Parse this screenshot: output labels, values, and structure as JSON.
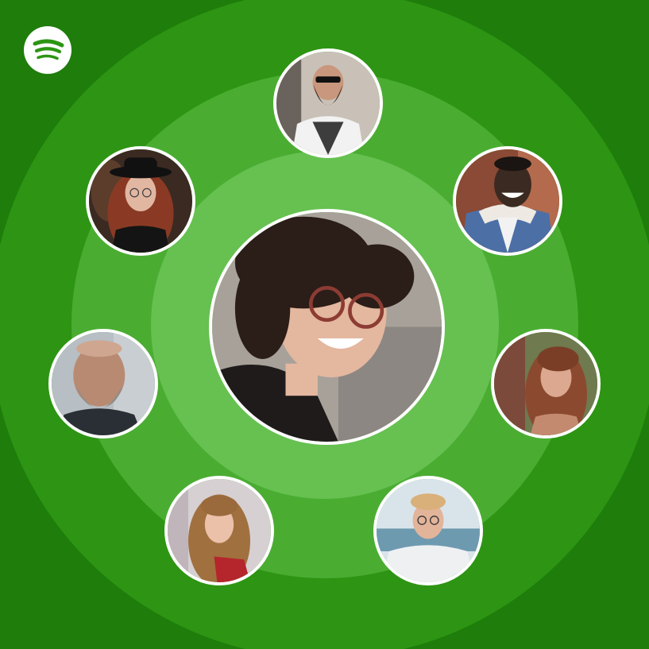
{
  "app": {
    "logo": "spotify-logo-icon",
    "brand_color": "#1ed760"
  },
  "background": {
    "base": "#1e7d0b",
    "ring_outer": "#2d9513",
    "ring_middle": "#4aad32",
    "ring_inner": "#66c150"
  },
  "avatars": [
    {
      "id": "center",
      "description": "woman-glasses-smiling"
    },
    {
      "id": "top",
      "description": "bearded-man-sunglasses"
    },
    {
      "id": "upper-left",
      "description": "woman-black-hat"
    },
    {
      "id": "upper-right",
      "description": "man-denim-jacket"
    },
    {
      "id": "left",
      "description": "older-man-beard"
    },
    {
      "id": "right",
      "description": "woman-long-hair"
    },
    {
      "id": "lower-left",
      "description": "girl-long-hair"
    },
    {
      "id": "lower-right",
      "description": "boy-glasses-beach"
    }
  ]
}
